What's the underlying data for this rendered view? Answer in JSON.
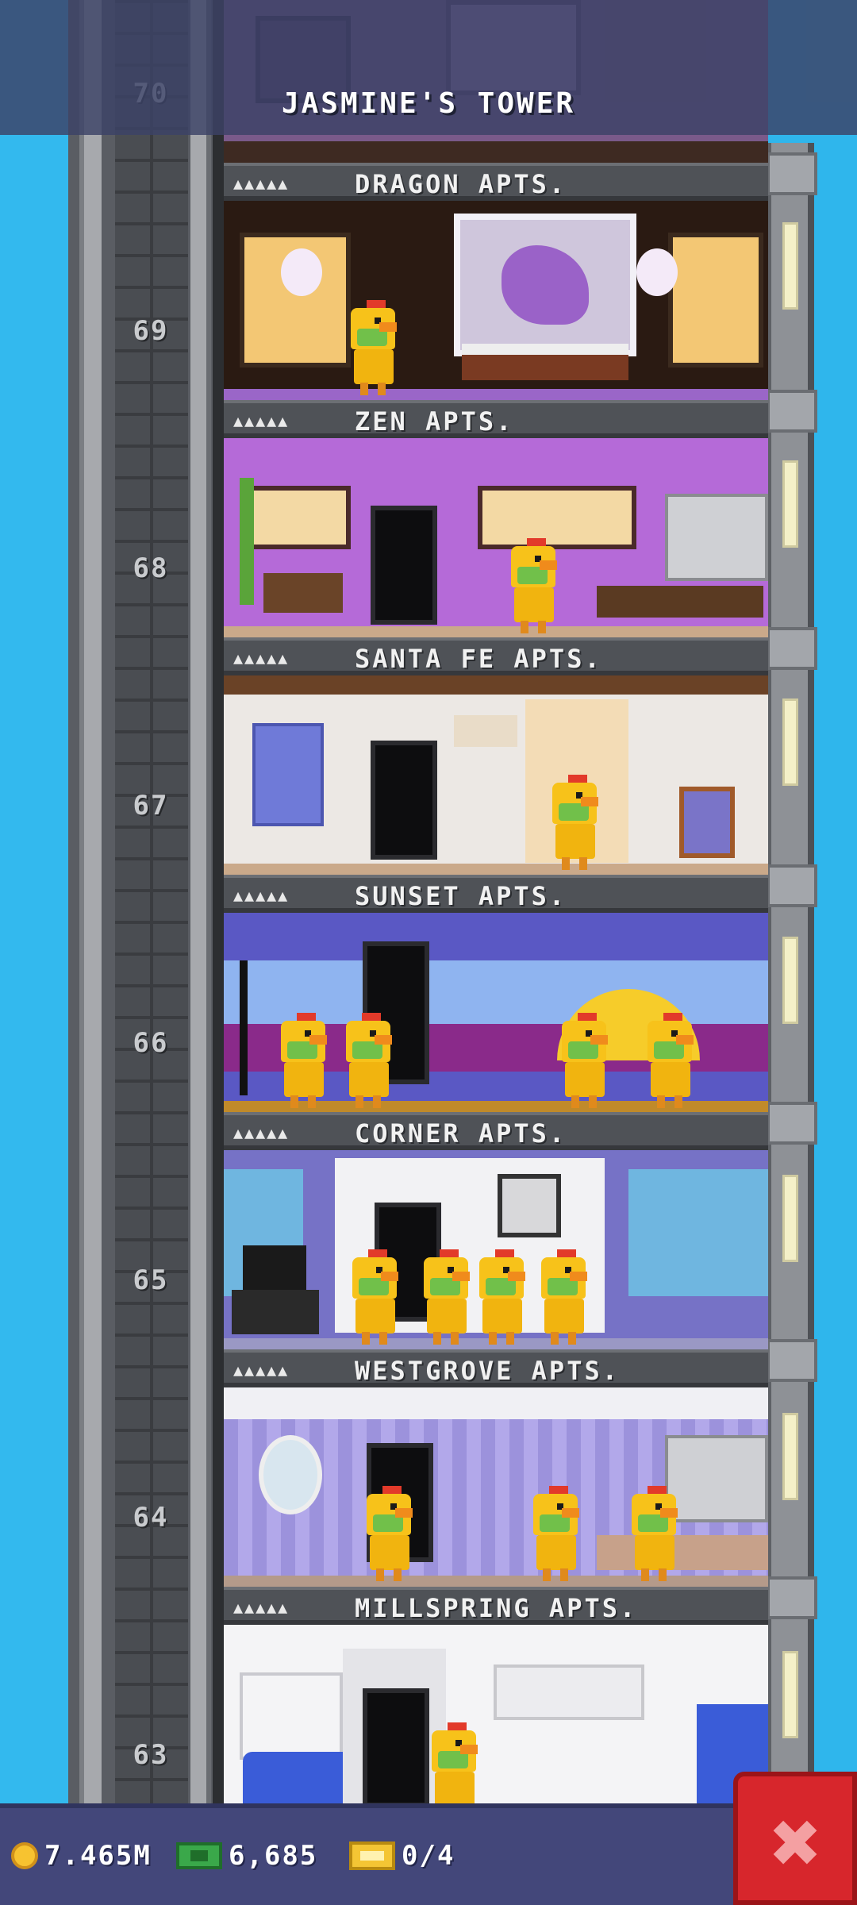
{
  "header": {
    "title": "JASMINE'S TOWER"
  },
  "floors": [
    {
      "number": "70",
      "stars": "▲▲▲▲▲",
      "name": "DRAGON APTS."
    },
    {
      "number": "69",
      "stars": "▲▲▲▲▲",
      "name": "ZEN APTS."
    },
    {
      "number": "68",
      "stars": "▲▲▲▲▲",
      "name": "SANTA FE APTS."
    },
    {
      "number": "67",
      "stars": "▲▲▲▲▲",
      "name": "SUNSET APTS."
    },
    {
      "number": "66",
      "stars": "▲▲▲▲▲",
      "name": "CORNER APTS."
    },
    {
      "number": "65",
      "stars": "▲▲▲▲▲",
      "name": "WESTGROVE APTS."
    },
    {
      "number": "64",
      "stars": "▲▲▲▲▲",
      "name": "MILLSPRING APTS."
    },
    {
      "number": "63"
    }
  ],
  "footer": {
    "coins": "7.465M",
    "bux": "6,685",
    "tickets": "0/4"
  },
  "close_button": {
    "label": "✖"
  },
  "colors": {
    "sky": "#2fb6ec",
    "header_bg": "#3c4266",
    "footer_bg": "#43477a",
    "close_red": "#d7262c"
  }
}
